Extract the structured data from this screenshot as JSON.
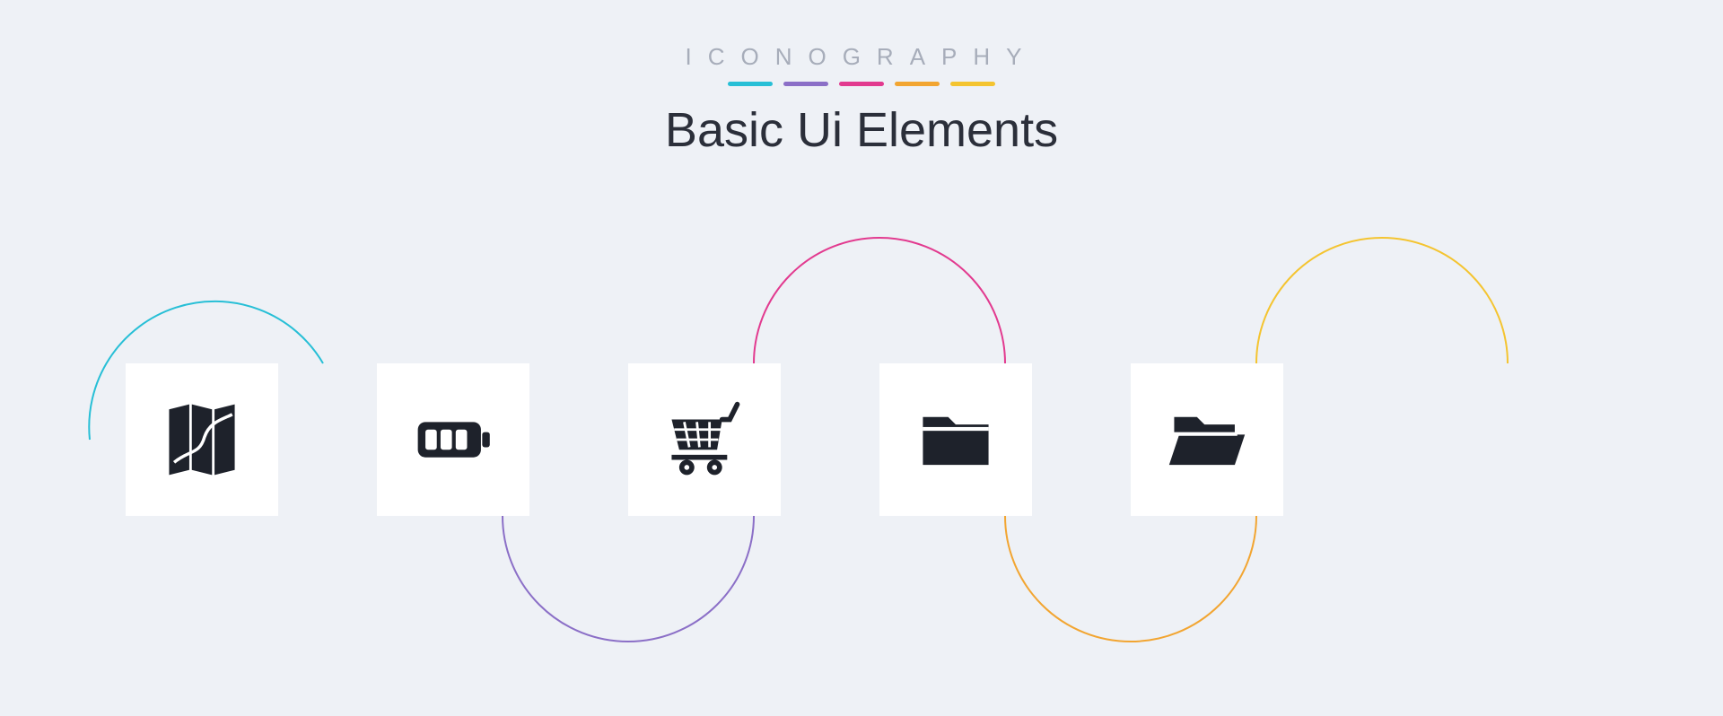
{
  "header": {
    "eyebrow": "ICONOGRAPHY",
    "title": "Basic Ui Elements"
  },
  "accent_colors": [
    "#27bfd6",
    "#8b6fc7",
    "#e23a8f",
    "#f2a531",
    "#f4c430"
  ],
  "icons": [
    {
      "name": "map-icon",
      "label": "Map"
    },
    {
      "name": "battery-icon",
      "label": "Battery"
    },
    {
      "name": "shopping-cart-icon",
      "label": "Shopping Cart"
    },
    {
      "name": "folder-icon",
      "label": "Folder"
    },
    {
      "name": "folder-open-icon",
      "label": "Open Folder"
    }
  ]
}
